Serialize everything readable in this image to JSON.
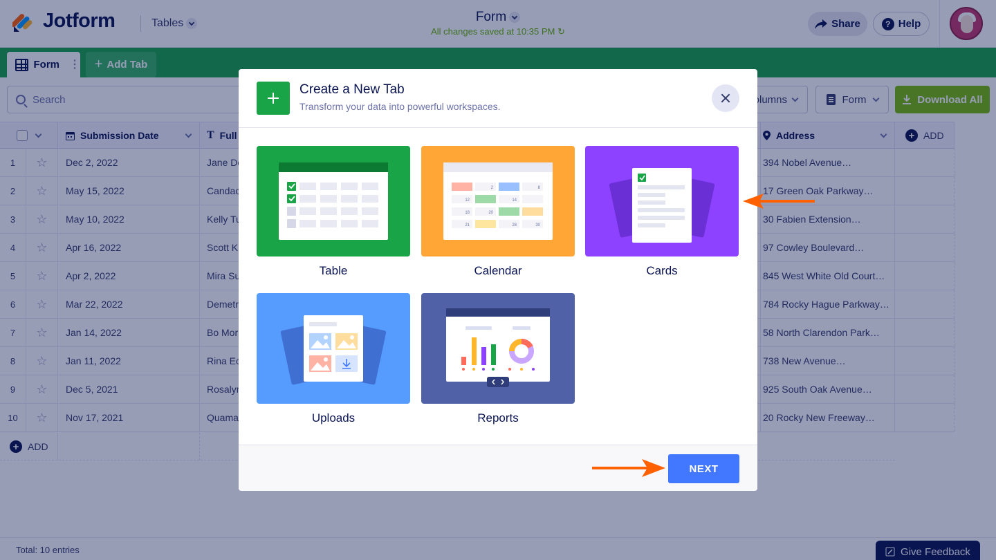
{
  "header": {
    "brand": "Jotform",
    "tables_link": "Tables",
    "form_title": "Form",
    "saved_status": "All changes saved at 10:35 PM",
    "share_label": "Share",
    "help_label": "Help"
  },
  "tabs": {
    "active_tab": "Form",
    "add_tab": "Add Tab"
  },
  "toolbar": {
    "search_placeholder": "Search",
    "columns_label": "Columns",
    "form_view_label": "Form",
    "download_label": "Download All"
  },
  "table": {
    "columns": {
      "date": "Submission Date",
      "name": "Full Name",
      "address": "Address",
      "add": "ADD"
    },
    "rows": [
      {
        "n": "1",
        "date": "Dec 2, 2022",
        "name": "Jane Do",
        "address": "394 Nobel Avenue…"
      },
      {
        "n": "2",
        "date": "May 15, 2022",
        "name": "Candac",
        "address": "17 Green Oak Parkway…"
      },
      {
        "n": "3",
        "date": "May 10, 2022",
        "name": "Kelly Tu",
        "address": "30 Fabien Extension…"
      },
      {
        "n": "4",
        "date": "Apr 16, 2022",
        "name": "Scott K",
        "address": "97 Cowley Boulevard…"
      },
      {
        "n": "5",
        "date": "Apr 2, 2022",
        "name": "Mira Su",
        "address": "845 West White Old Court…"
      },
      {
        "n": "6",
        "date": "Mar 22, 2022",
        "name": "Demetr",
        "address": "784 Rocky Hague Parkway…"
      },
      {
        "n": "7",
        "date": "Jan 14, 2022",
        "name": "Bo Mor",
        "address": "58 North Clarendon Park…"
      },
      {
        "n": "8",
        "date": "Jan 11, 2022",
        "name": "Rina Ec",
        "address": "738 New Avenue…"
      },
      {
        "n": "9",
        "date": "Dec 5, 2021",
        "name": "Rosalyn",
        "address": "925 South Oak Avenue…"
      },
      {
        "n": "10",
        "date": "Nov 17, 2021",
        "name": "Quama",
        "address": "20 Rocky New Freeway…"
      }
    ],
    "add_row_label": "ADD"
  },
  "footer": {
    "total": "Total: 10 entries",
    "feedback": "Give Feedback"
  },
  "modal": {
    "title": "Create a New Tab",
    "subtitle": "Transform your data into powerful workspaces.",
    "cards": [
      {
        "label": "Table",
        "color": "#18a447"
      },
      {
        "label": "Calendar",
        "color": "#ffa637"
      },
      {
        "label": "Cards",
        "color": "#8c42ff"
      },
      {
        "label": "Uploads",
        "color": "#569cff"
      },
      {
        "label": "Reports",
        "color": "#5061a8"
      }
    ],
    "next_label": "NEXT"
  },
  "calendar_numbers": [
    "2",
    "8",
    "12",
    "14",
    "18",
    "20",
    "21",
    "28",
    "30"
  ],
  "colors": {
    "jotform_green": "#18a447",
    "accent_blue": "#4277ff",
    "annotation_orange": "#ff6100"
  }
}
